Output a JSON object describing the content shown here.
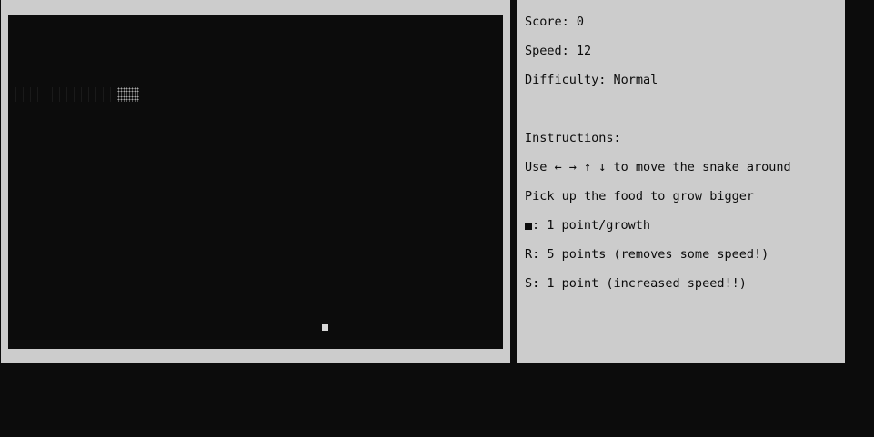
{
  "stats": {
    "score_label": "Score: ",
    "score": "0",
    "speed_label": "Speed: ",
    "speed": "12",
    "difficulty_label": "Difficulty: ",
    "difficulty": "Normal"
  },
  "instructions": {
    "heading": "Instructions:",
    "move": "Use ← → ↑ ↓ to move the snake around",
    "grow": "Pick up the food to grow bigger",
    "food_normal": ": 1 point/growth",
    "food_r": "R: 5 points (removes some speed!)",
    "food_s": "S: 1 point (increased speed!!)"
  },
  "board": {
    "snake_length_segments": 14,
    "colors": {
      "background": "#0c0c0c",
      "panel": "#cccccc",
      "food": "#d8d8d8",
      "snake_head": "#a8a8a8"
    },
    "icons": {
      "food_glyph": "black-square-icon"
    }
  }
}
